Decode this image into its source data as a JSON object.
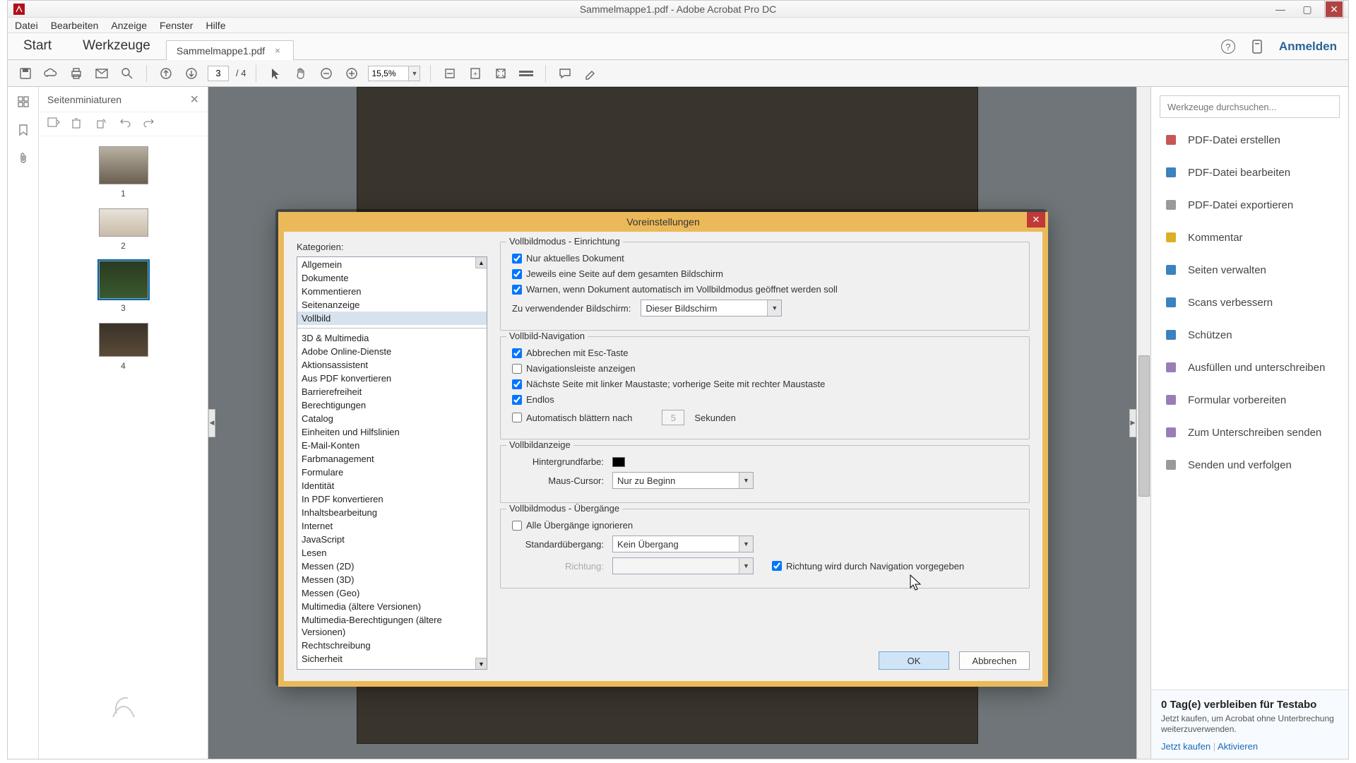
{
  "window": {
    "title": "Sammelmappe1.pdf - Adobe Acrobat Pro DC"
  },
  "menubar": [
    "Datei",
    "Bearbeiten",
    "Anzeige",
    "Fenster",
    "Hilfe"
  ],
  "tabs": {
    "primary": [
      "Start",
      "Werkzeuge"
    ],
    "doc_tab": "Sammelmappe1.pdf",
    "signin": "Anmelden"
  },
  "toolbar": {
    "page_current": "3",
    "page_total": "/ 4",
    "zoom": "15,5%"
  },
  "thumbs": {
    "title": "Seitenminiaturen",
    "pages": [
      "1",
      "2",
      "3",
      "4"
    ]
  },
  "rtools": {
    "search_placeholder": "Werkzeuge durchsuchen...",
    "items": [
      "PDF-Datei erstellen",
      "PDF-Datei bearbeiten",
      "PDF-Datei exportieren",
      "Kommentar",
      "Seiten verwalten",
      "Scans verbessern",
      "Schützen",
      "Ausfüllen und unterschreiben",
      "Formular vorbereiten",
      "Zum Unterschreiben senden",
      "Senden und verfolgen"
    ],
    "trial": {
      "headline": "0 Tag(e) verbleiben für Testabo",
      "desc": "Jetzt kaufen, um Acrobat ohne Unterbrechung weiterzuverwenden.",
      "buy": "Jetzt kaufen",
      "activate": "Aktivieren"
    }
  },
  "dialog": {
    "title": "Voreinstellungen",
    "categories_label": "Kategorien:",
    "categories_top": [
      "Allgemein",
      "Dokumente",
      "Kommentieren",
      "Seitenanzeige",
      "Vollbild"
    ],
    "categories_rest": [
      "3D & Multimedia",
      "Adobe Online-Dienste",
      "Aktionsassistent",
      "Aus PDF konvertieren",
      "Barrierefreiheit",
      "Berechtigungen",
      "Catalog",
      "Einheiten und Hilfslinien",
      "E-Mail-Konten",
      "Farbmanagement",
      "Formulare",
      "Identität",
      "In PDF konvertieren",
      "Inhaltsbearbeitung",
      "Internet",
      "JavaScript",
      "Lesen",
      "Messen (2D)",
      "Messen (3D)",
      "Messen (Geo)",
      "Multimedia (ältere Versionen)",
      "Multimedia-Berechtigungen (ältere Versionen)",
      "Rechtschreibung",
      "Sicherheit"
    ],
    "selected_category": "Vollbild",
    "sections": {
      "setup": {
        "legend": "Vollbildmodus - Einrichtung",
        "c_only_current": "Nur aktuelles Dokument",
        "c_one_page": "Jeweils eine Seite auf dem gesamten Bildschirm",
        "c_warn": "Warnen, wenn Dokument automatisch im Vollbildmodus geöffnet werden soll",
        "monitor_label": "Zu verwendender Bildschirm:",
        "monitor_value": "Dieser Bildschirm"
      },
      "nav": {
        "legend": "Vollbild-Navigation",
        "c_esc": "Abbrechen mit Esc-Taste",
        "c_navbar": "Navigationsleiste anzeigen",
        "c_click": "Nächste Seite mit linker Maustaste; vorherige Seite mit rechter Maustaste",
        "c_loop": "Endlos",
        "c_autoflip": "Automatisch blättern nach",
        "autoflip_value": "5",
        "autoflip_unit": "Sekunden"
      },
      "display": {
        "legend": "Vollbildanzeige",
        "bg_label": "Hintergrundfarbe:",
        "cursor_label": "Maus-Cursor:",
        "cursor_value": "Nur zu Beginn"
      },
      "trans": {
        "legend": "Vollbildmodus - Übergänge",
        "c_ignore": "Alle Übergänge ignorieren",
        "default_label": "Standardübergang:",
        "default_value": "Kein Übergang",
        "direction_label": "Richtung:",
        "direction_value": "",
        "c_navdir": "Richtung wird durch Navigation vorgegeben"
      }
    },
    "ok": "OK",
    "cancel": "Abbrechen"
  }
}
